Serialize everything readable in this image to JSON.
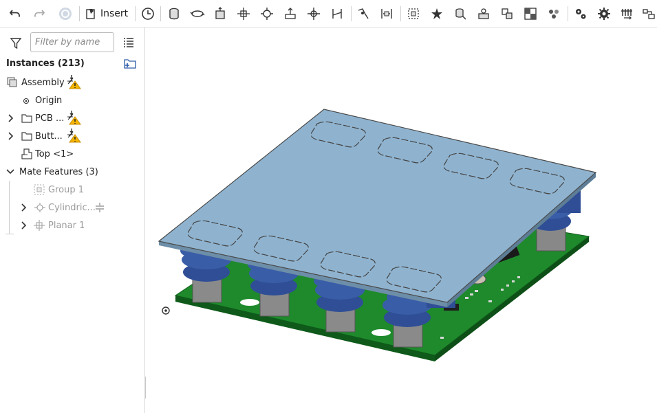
{
  "toolbar": {
    "undo": "undo-icon",
    "redo": "redo-icon",
    "insert_label": "Insert"
  },
  "panel": {
    "filter_placeholder": "Filter by name",
    "instances_title": "Instances (213)",
    "tree": [
      {
        "label": "Assembly",
        "warn": true
      },
      {
        "label": "Origin"
      },
      {
        "label": "PCB ...",
        "warn": true
      },
      {
        "label": "Butt...",
        "warn": true
      },
      {
        "label": "Top <1>"
      },
      {
        "label": "Mate Features (3)"
      },
      {
        "label": "Group 1"
      },
      {
        "label": "Cylindric..."
      },
      {
        "label": "Planar 1"
      }
    ]
  },
  "colors": {
    "top_plate": "#8fb3cf",
    "pcb": "#1e8a2c",
    "button_blue": "#3a5da8",
    "button_gray": "#8a8a8a",
    "warning": "#f5b400"
  }
}
